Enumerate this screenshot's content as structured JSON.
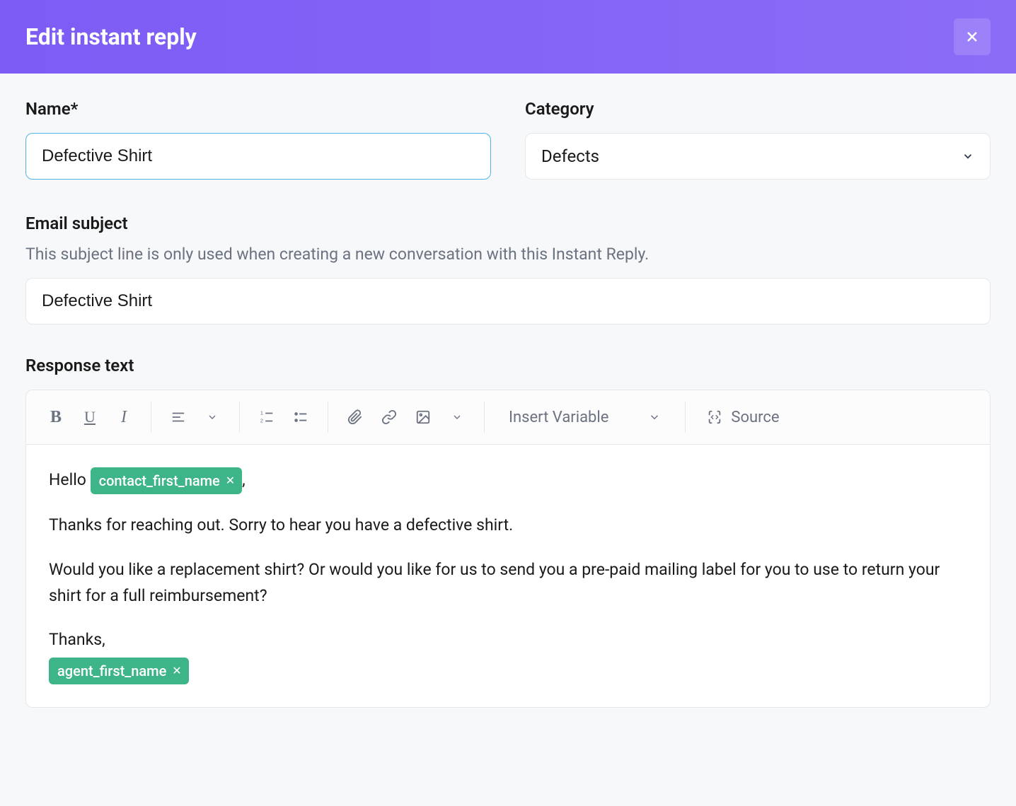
{
  "header": {
    "title": "Edit instant reply"
  },
  "fields": {
    "name": {
      "label": "Name*",
      "value": "Defective Shirt"
    },
    "category": {
      "label": "Category",
      "value": "Defects"
    },
    "emailSubject": {
      "label": "Email subject",
      "hint": "This subject line is only used when creating a new conversation with this Instant Reply.",
      "value": "Defective Shirt"
    },
    "responseText": {
      "label": "Response text"
    }
  },
  "toolbar": {
    "insertVariable": "Insert Variable",
    "source": "Source"
  },
  "response": {
    "greeting": "Hello ",
    "var1": "contact_first_name",
    "afterGreeting": ",",
    "body1": "Thanks for reaching out. Sorry to hear you have a defective shirt.",
    "body2": "Would you like a replacement shirt? Or would you like for us to send you a pre-paid mailing label for you to use to return your shirt for a full reimbursement?",
    "closing": "Thanks,",
    "var2": "agent_first_name"
  }
}
